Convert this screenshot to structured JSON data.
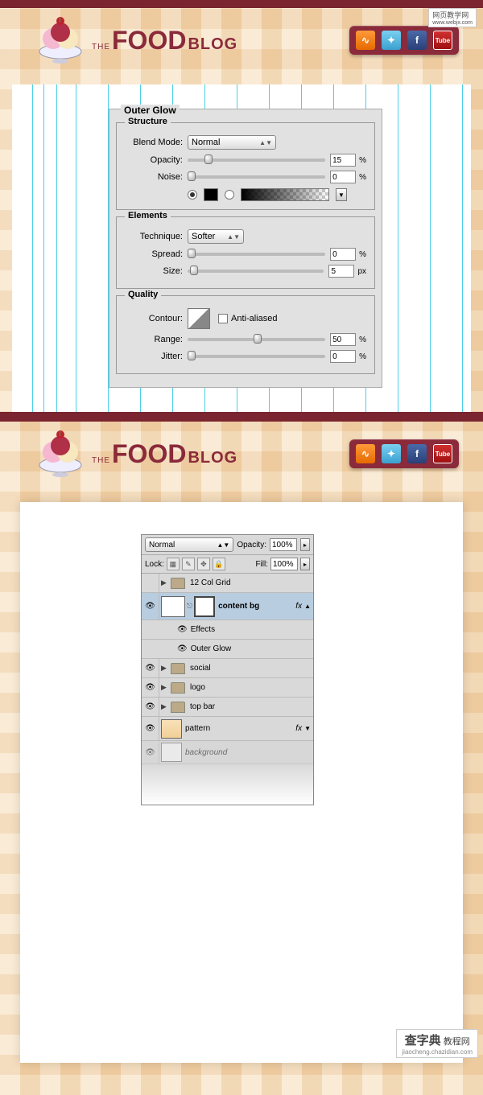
{
  "badge_top": "网页教学网",
  "badge_top_url": "www.webjx.com",
  "logo": {
    "the": "THE",
    "food": "FOOD",
    "blog": "BLOG"
  },
  "outer_glow": {
    "title": "Outer Glow",
    "structure": {
      "legend": "Structure",
      "blend_mode_label": "Blend Mode:",
      "blend_mode_value": "Normal",
      "opacity_label": "Opacity:",
      "opacity_value": "15",
      "noise_label": "Noise:",
      "noise_value": "0",
      "pct": "%"
    },
    "elements": {
      "legend": "Elements",
      "technique_label": "Technique:",
      "technique_value": "Softer",
      "spread_label": "Spread:",
      "spread_value": "0",
      "size_label": "Size:",
      "size_value": "5",
      "pct": "%",
      "px": "px"
    },
    "quality": {
      "legend": "Quality",
      "contour_label": "Contour:",
      "aa_label": "Anti-aliased",
      "range_label": "Range:",
      "range_value": "50",
      "jitter_label": "Jitter:",
      "jitter_value": "0",
      "pct": "%"
    }
  },
  "layers_panel": {
    "blend_value": "Normal",
    "opacity_label": "Opacity:",
    "opacity_value": "100%",
    "lock_label": "Lock:",
    "fill_label": "Fill:",
    "fill_value": "100%",
    "rows": {
      "grid": "12 Col Grid",
      "content_bg": "content bg",
      "effects": "Effects",
      "outer_glow": "Outer Glow",
      "social": "social",
      "logo": "logo",
      "top_bar": "top bar",
      "pattern": "pattern",
      "background": "background"
    },
    "fx": "fx"
  },
  "footer": {
    "main": "查字典",
    "sub": "教程网",
    "url": "jiaocheng.chazidian.com"
  }
}
